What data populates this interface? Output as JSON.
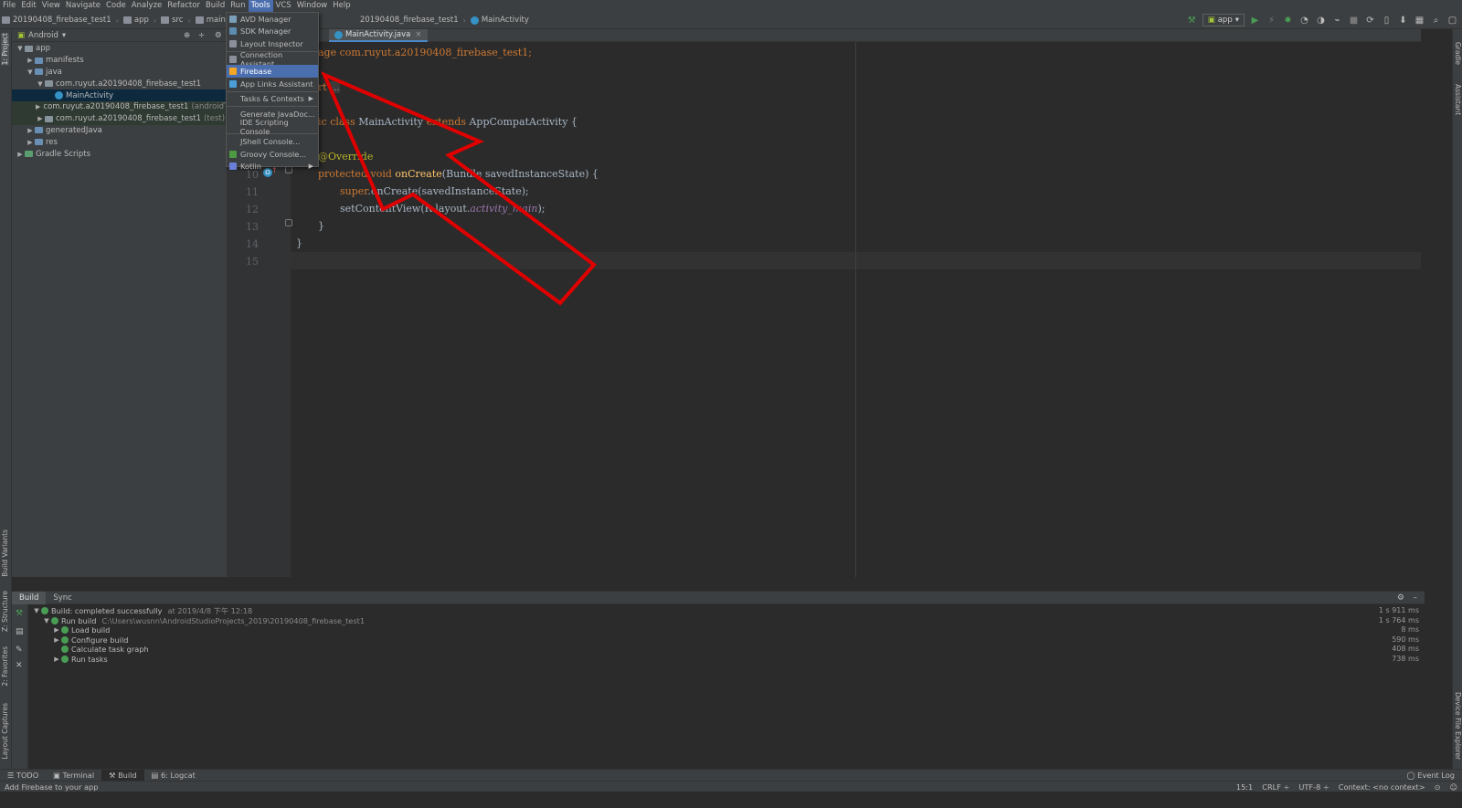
{
  "menu": [
    "File",
    "Edit",
    "View",
    "Navigate",
    "Code",
    "Analyze",
    "Refactor",
    "Build",
    "Run",
    "Tools",
    "VCS",
    "Window",
    "Help"
  ],
  "breadcrumb": {
    "project": "20190408_firebase_test1",
    "module": "app",
    "src": "src",
    "main": "main",
    "java": "java",
    "pkg": "20190408_firebase_test1",
    "cls": "MainActivity"
  },
  "run_config": "app",
  "project_panel": {
    "mode": "Android",
    "tree": [
      {
        "label": "app",
        "extra": "",
        "depth": 0,
        "arrow": "▼",
        "icon": "folder"
      },
      {
        "label": "manifests",
        "extra": "",
        "depth": 1,
        "arrow": "▶",
        "icon": "folder"
      },
      {
        "label": "java",
        "extra": "",
        "depth": 1,
        "arrow": "▼",
        "icon": "folder"
      },
      {
        "label": "com.ruyut.a20190408_firebase_test1",
        "extra": "",
        "depth": 2,
        "arrow": "▼",
        "icon": "folder"
      },
      {
        "label": "MainActivity",
        "extra": "",
        "depth": 3,
        "arrow": "",
        "icon": "class"
      },
      {
        "label": "com.ruyut.a20190408_firebase_test1",
        "extra": "(androidTest)",
        "depth": 2,
        "arrow": "▶",
        "icon": "folder"
      },
      {
        "label": "com.ruyut.a20190408_firebase_test1",
        "extra": "(test)",
        "depth": 2,
        "arrow": "▶",
        "icon": "folder"
      },
      {
        "label": "generatedJava",
        "extra": "",
        "depth": 1,
        "arrow": "▶",
        "icon": "folder"
      },
      {
        "label": "res",
        "extra": "",
        "depth": 1,
        "arrow": "▶",
        "icon": "folder"
      },
      {
        "label": "Gradle Scripts",
        "extra": "",
        "depth": 0,
        "arrow": "▶",
        "icon": "gradle"
      }
    ]
  },
  "editor_tab": "MainActivity.java",
  "code": {
    "l1": "age com.ruyut.a20190408_firebase_test1;",
    "l3a": "rt ",
    "l3b": "...",
    "l5a": "ic ",
    "l5b": "class ",
    "l5c": "MainActivity ",
    "l5d": "extends ",
    "l5e": "AppCompatActivity {",
    "l9": "@Override",
    "l10a": "protected ",
    "l10b": "void ",
    "l10c": "onCreate",
    "l10d": "(Bundle savedInstanceState) {",
    "l11a": "super",
    "l11b": ".onCreate(savedInstanceState);",
    "l12a": "setContentView(R.layout.",
    "l12b": "activity_main",
    "l12c": ");",
    "l13": "}",
    "l14": "}"
  },
  "line_numbers": [
    "10",
    "11",
    "12",
    "13",
    "14",
    "15"
  ],
  "tools_menu": {
    "items": [
      {
        "label": "AVD Manager",
        "sub": false,
        "hl": false,
        "sep_after": false
      },
      {
        "label": "SDK Manager",
        "sub": false,
        "hl": false,
        "sep_after": false
      },
      {
        "label": "Layout Inspector",
        "sub": false,
        "hl": false,
        "sep_after": true
      },
      {
        "label": "Connection Assistant",
        "sub": false,
        "hl": false,
        "sep_after": false
      },
      {
        "label": "Firebase",
        "sub": false,
        "hl": true,
        "sep_after": false
      },
      {
        "label": "App Links Assistant",
        "sub": false,
        "hl": false,
        "sep_after": true
      },
      {
        "label": "Tasks & Contexts",
        "sub": true,
        "hl": false,
        "sep_after": true
      },
      {
        "label": "Generate JavaDoc...",
        "sub": false,
        "hl": false,
        "sep_after": false
      },
      {
        "label": "IDE Scripting Console",
        "sub": false,
        "hl": false,
        "sep_after": true
      },
      {
        "label": "JShell Console...",
        "sub": false,
        "hl": false,
        "sep_after": false
      },
      {
        "label": "Groovy Console...",
        "sub": false,
        "hl": false,
        "sep_after": false
      },
      {
        "label": "Kotlin",
        "sub": true,
        "hl": false,
        "sep_after": false
      }
    ]
  },
  "build": {
    "tabs": [
      "Build",
      "Sync"
    ],
    "rows": [
      {
        "label": "Build: completed successfully",
        "detail": "at 2019/4/8 下午 12:18",
        "time": "1 s 911 ms",
        "depth": 0,
        "arrow": "▼"
      },
      {
        "label": "Run build",
        "detail": "C:\\Users\\wusnn\\AndroidStudioProjects_2019\\20190408_firebase_test1",
        "time": "1 s 764 ms",
        "depth": 1,
        "arrow": "▼"
      },
      {
        "label": "Load build",
        "detail": "",
        "time": "8 ms",
        "depth": 2,
        "arrow": "▶"
      },
      {
        "label": "Configure build",
        "detail": "",
        "time": "590 ms",
        "depth": 2,
        "arrow": "▶"
      },
      {
        "label": "Calculate task graph",
        "detail": "",
        "time": "408 ms",
        "depth": 2,
        "arrow": ""
      },
      {
        "label": "Run tasks",
        "detail": "",
        "time": "738 ms",
        "depth": 2,
        "arrow": "▶"
      }
    ]
  },
  "side": {
    "left": [
      "1: Project",
      "Build Variants",
      "Z: Structure",
      "2: Favorites",
      "Layout Captures"
    ],
    "right": [
      "Gradle",
      "Assistant",
      "Device File Explorer"
    ]
  },
  "bottom_tabs": [
    "TODO",
    "Terminal",
    "Build",
    "6: Logcat"
  ],
  "event_log": "Event Log",
  "status": {
    "message": "Add Firebase to your app",
    "pos": "15:1",
    "crlf": "CRLF ÷",
    "enc": "UTF-8 ÷",
    "ctx": "Context: <no context>"
  },
  "accent": "#4b6eaf",
  "arrow_color": "#e00000"
}
